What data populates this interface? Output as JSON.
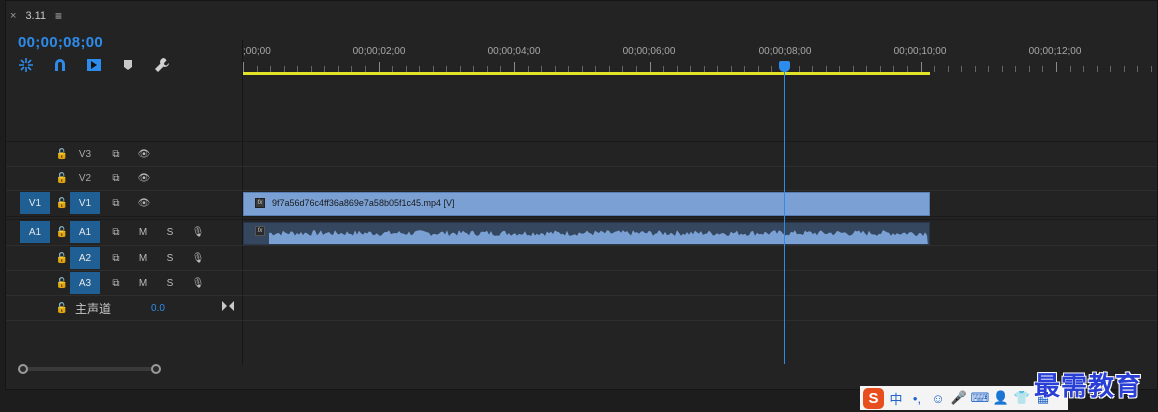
{
  "tab": {
    "close_glyph": "×",
    "title": "3.11",
    "menu_glyph": "≡"
  },
  "timecode": "00;00;08;00",
  "tools": [
    {
      "name": "nest-icon"
    },
    {
      "name": "snap-icon"
    },
    {
      "name": "linked-selection-icon"
    },
    {
      "name": "add-marker-icon"
    },
    {
      "name": "settings-wrench-icon"
    }
  ],
  "ruler": {
    "labels": [
      ";00;00",
      "00;00;02;00",
      "00;00;04;00",
      "00;00;06;00",
      "00;00;08;00",
      "00;00;10;00",
      "00;00;12;00"
    ]
  },
  "tracks": {
    "video": [
      {
        "id": "V3",
        "source": "",
        "lock": "🔓",
        "sync": "⧉",
        "eye": "👁"
      },
      {
        "id": "V2",
        "source": "",
        "lock": "🔓",
        "sync": "⧉",
        "eye": "👁"
      },
      {
        "id": "V1",
        "source": "V1",
        "lock": "🔓",
        "sync": "⧉",
        "eye": "👁"
      }
    ],
    "audio": [
      {
        "id": "A1",
        "source": "A1",
        "mute": "M",
        "solo": "S"
      },
      {
        "id": "A2",
        "source": "",
        "mute": "M",
        "solo": "S"
      },
      {
        "id": "A3",
        "source": "",
        "mute": "M",
        "solo": "S"
      }
    ],
    "master": {
      "label": "主声道",
      "value": "0.0"
    }
  },
  "clips": {
    "video_name": "9f7a56d76c4ff36a869e7a58b05f1c45.mp4 [V]",
    "fx_badge": "fx"
  },
  "playhead": {
    "time": "00;00;08;00",
    "seconds": 8
  },
  "ime": {
    "logo": "S",
    "items": [
      "中",
      "•,",
      "☺",
      "🎤",
      "⌨",
      "👤",
      "👕",
      "▦"
    ]
  },
  "watermark": "最需教育",
  "colors": {
    "accent": "#2d8ceb",
    "work_area": "#e3e32a",
    "video_clip": "#7aa0d4",
    "audio_clip": "#34475e"
  }
}
